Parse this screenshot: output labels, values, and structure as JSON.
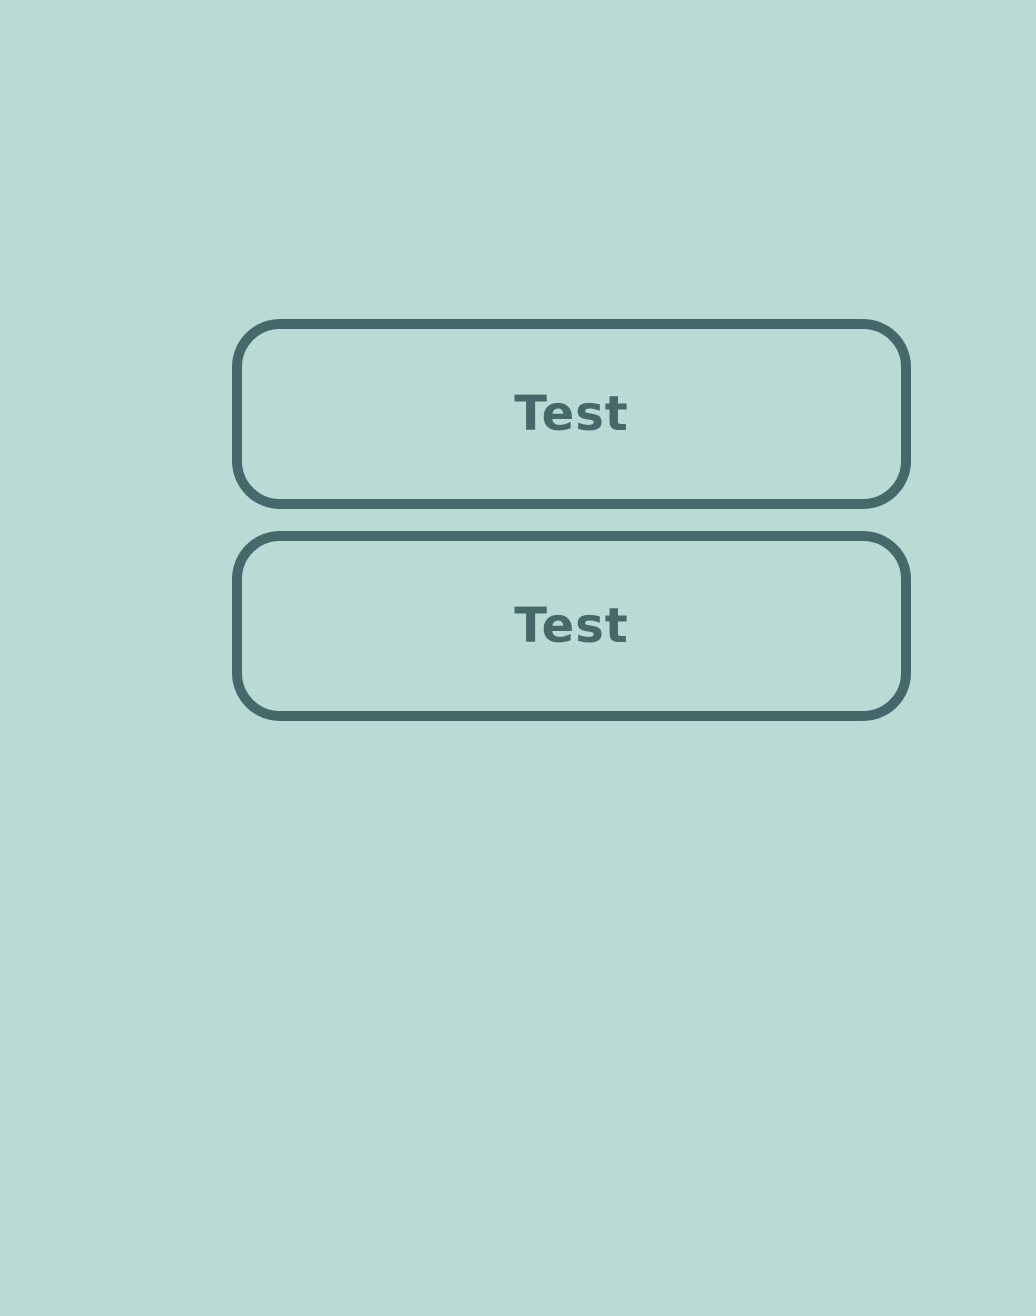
{
  "buttons": [
    {
      "label": "Test"
    },
    {
      "label": "Test"
    }
  ],
  "colors": {
    "background": "#badad5",
    "accent": "#45696b"
  }
}
